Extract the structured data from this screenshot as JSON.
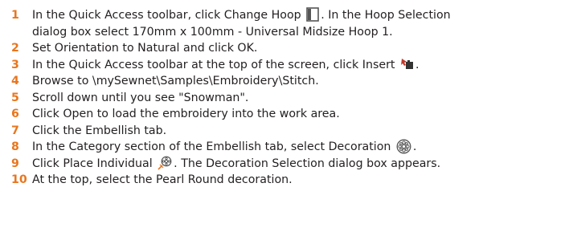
{
  "colors": {
    "step_number": "#e8761e",
    "text": "#231f20"
  },
  "steps": [
    {
      "num": "1",
      "before": "In the Quick Access toolbar, click Change Hoop",
      "icon": "change-hoop-icon",
      "after": ". In the Hoop Selection",
      "line2": "dialog box select 170mm x 100mm - Universal Midsize Hoop 1."
    },
    {
      "num": "2",
      "text": "Set Orientation to Natural and click OK."
    },
    {
      "num": "3",
      "before": "In the Quick Access toolbar at the top of the screen, click Insert",
      "icon": "insert-icon",
      "after": "."
    },
    {
      "num": "4",
      "text": "Browse to \\mySewnet\\Samples\\Embroidery\\Stitch."
    },
    {
      "num": "5",
      "text": "Scroll down until you see \"Snowman\"."
    },
    {
      "num": "6",
      "text": "Click Open to load the embroidery into the work area."
    },
    {
      "num": "7",
      "text": "Click the Embellish tab."
    },
    {
      "num": "8",
      "before": "In the Category section of the Embellish tab, select Decoration",
      "icon": "decoration-icon",
      "after": "."
    },
    {
      "num": "9",
      "before": "Click Place Individual",
      "icon": "place-individual-icon",
      "after": ". The Decoration Selection dialog box appears."
    },
    {
      "num": "10",
      "text": "At the top, select the Pearl Round decoration."
    }
  ]
}
